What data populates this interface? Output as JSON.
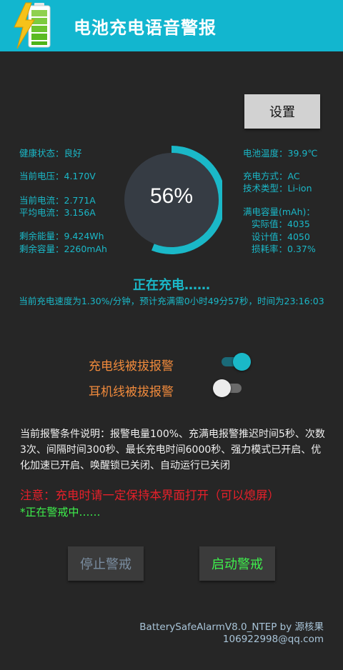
{
  "header": {
    "title": "电池充电语音警报",
    "icon": "battery-charging-icon",
    "color": "#12b6cf"
  },
  "settings_button": "设置",
  "left_info": {
    "health": "健康状态：良好",
    "voltage": "当前电压：4.170V",
    "current": "当前电流：2.771A",
    "avg_current": "平均电流：3.156A",
    "remaining_energy": "剩余能量：9.424Wh",
    "remaining_capacity": "剩余容量：2260mAh"
  },
  "right_info": {
    "temperature": "电池温度：39.9℃",
    "charge_type": "充电方式：AC",
    "tech_type": "技术类型：Li-ion",
    "full_capacity": "满电容量(mAh)：",
    "actual": "实际值：4035",
    "design": "设计值：4050",
    "wear": "损耗率：0.37%"
  },
  "gauge": {
    "percent_text": "56%",
    "level": 0.56,
    "arc_color": "#1ab8c8"
  },
  "charging": {
    "status": "正在充电……",
    "detail": "当前充电速度为1.30%/分钟，预计充满需0小时49分57秒，时间为23:16:03"
  },
  "toggles": [
    {
      "label": "充电线被拔报警",
      "on": true
    },
    {
      "label": "耳机线被拔报警",
      "on": false
    }
  ],
  "description": "当前报警条件说明：报警电量100%、充满电报警推迟时间5秒、次数3次、间隔时间300秒、最长充电时间6000秒、强力模式已开启、优化加速已开启、唤醒锁已关闭、自动运行已关闭",
  "notice": "注意：充电时请一定保持本界面打开（可以熄屏）",
  "watching": "*正在警戒中……",
  "buttons": {
    "stop": "停止警戒",
    "start": "启动警戒"
  },
  "footer": {
    "version": "BatterySafeAlarmV8.0_NTEP by 源核果",
    "email": "106922998@qq.com"
  }
}
